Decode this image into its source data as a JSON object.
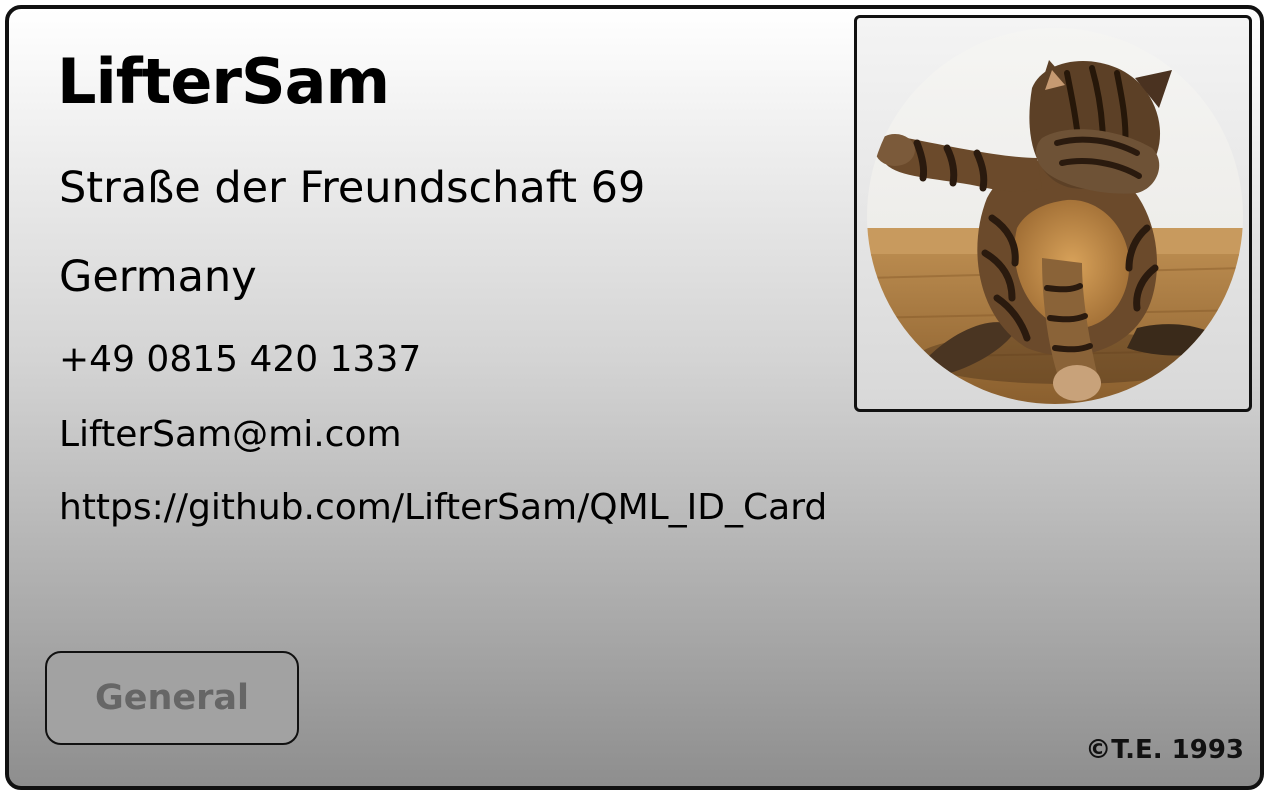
{
  "card": {
    "name": "LifterSam",
    "street": "Straße der Freundschaft 69",
    "country": "Germany",
    "phone": "+49 0815 420 1337",
    "email": "LifterSam@mi.com",
    "github": "https://github.com/LifterSam/QML_ID_Card",
    "photo_subject": "cat-photo",
    "button_label": "General",
    "copyright": "©T.E. 1993"
  },
  "colors": {
    "border": "#111111",
    "gradient_top": "#ffffff",
    "gradient_bottom": "#8e8e8e",
    "button_bg": "#a2a2a2",
    "button_text": "#666666"
  }
}
